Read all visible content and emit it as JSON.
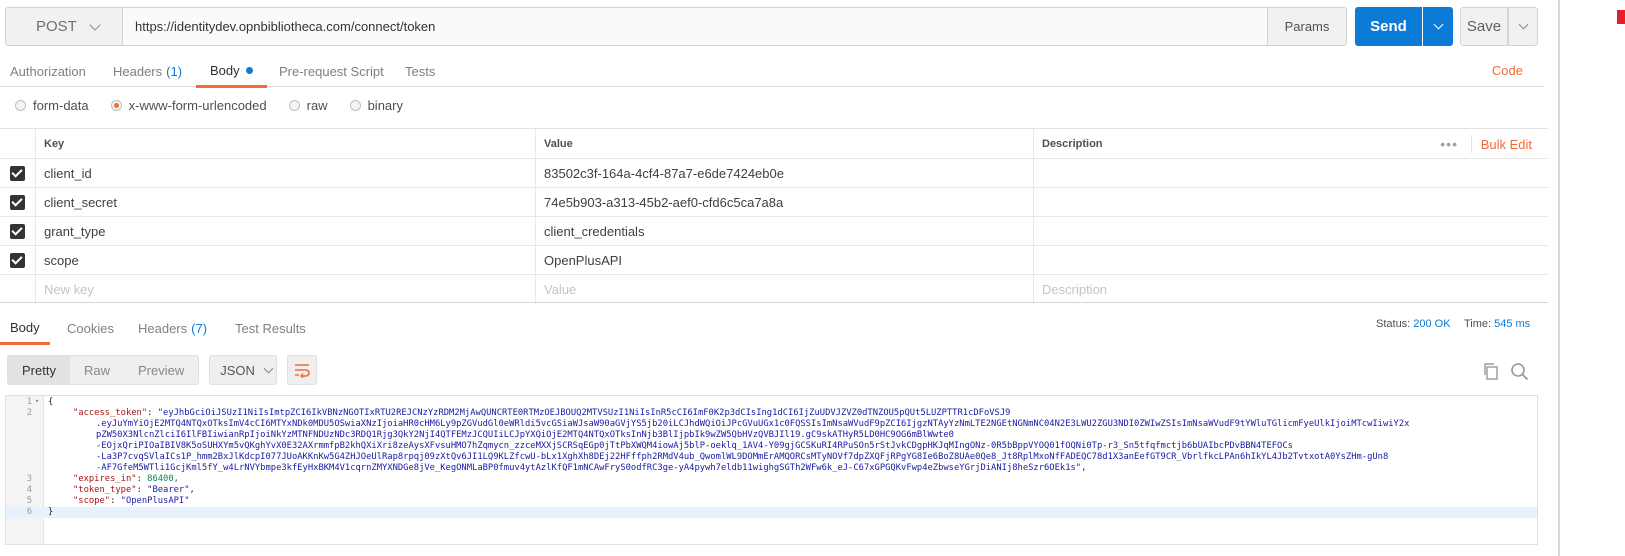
{
  "request": {
    "method": "POST",
    "url": "https://identitydev.opnbibliotheca.com/connect/token",
    "params_label": "Params",
    "send_label": "Send",
    "save_label": "Save"
  },
  "request_tabs": [
    {
      "label": "Authorization"
    },
    {
      "label": "Headers",
      "count": "(1)"
    },
    {
      "label": "Body"
    },
    {
      "label": "Pre-request Script"
    },
    {
      "label": "Tests"
    }
  ],
  "code_link": "Code",
  "body_types": [
    {
      "label": "form-data"
    },
    {
      "label": "x-www-form-urlencoded"
    },
    {
      "label": "raw"
    },
    {
      "label": "binary"
    }
  ],
  "kv_table": {
    "headers": {
      "key": "Key",
      "value": "Value",
      "description": "Description"
    },
    "more": "•••",
    "bulk_edit": "Bulk Edit",
    "rows": [
      {
        "key": "client_id",
        "value": "83502c3f-164a-4cf4-87a7-e6de7424eb0e"
      },
      {
        "key": "client_secret",
        "value": "74e5b903-a313-45b2-aef0-cfd6c5ca7a8a"
      },
      {
        "key": "grant_type",
        "value": "client_credentials"
      },
      {
        "key": "scope",
        "value": "OpenPlusAPI"
      }
    ],
    "new_row": {
      "key": "New key",
      "value": "Value",
      "description": "Description"
    }
  },
  "response_tabs": [
    {
      "label": "Body"
    },
    {
      "label": "Cookies"
    },
    {
      "label": "Headers",
      "count": "(7)"
    },
    {
      "label": "Test Results"
    }
  ],
  "status": {
    "label": "Status:",
    "value": "200 OK"
  },
  "time": {
    "label": "Time:",
    "value": "545 ms"
  },
  "view_modes": [
    "Pretty",
    "Raw",
    "Preview"
  ],
  "format": "JSON",
  "response_json": {
    "open": "{",
    "close": "}",
    "access_token_key": "\"access_token\"",
    "access_token_lines": [
      "\"eyJhbGciOiJSUzI1NiIsImtpZCI6IkVBNzNGOTIxRTU2REJCNzYzRDM2MjAwQUNCRTE0RTMzOEJBOUQ2MTVSUzI1NiIsInR5cCI6ImF0K2p3dCIsIng1dCI6IjZuUDVJZVZ0dTNZOU5pQUt5LUZPTTR1cDFoVSJ9",
      ".eyJuYmYiOjE2MTQ4NTQxOTksImV4cCI6MTYxNDk0MDU5OSwiaXNzIjoiaHR0cHM6Ly9pZGVudGl0eWRldi5vcGSiaWJsaW90aGVjYS5jb20iLCJhdWQiOiJPcGVuUGx1c0FQSSIsImNsaWVudF9pZCI6IjgzNTAyYzNmLTE2NGEtNGNmNC04N2E3LWU2ZGU3NDI0ZWIwZSIsImNsaWVudF9tYWluTGlicmFyeUlkIjoiMTcwIiwiY2x",
      "pZW50X3NlcnZlciI6IlFBIiwianRpIjoiNkYzMTNFNDUzNDc3RDQ1Rjg3QkY2NjI4QTFEMzJCQUIiLCJpYXQiOjE2MTQ4NTQxOTksInNjb3BlIjpbIk9wZW5QbHVzQVBJIl19.gC9skATHyR5LD0HC9OG6mBlWwte0",
      "-EOjxQriPIOaIBIV8K5oSUHXYm5vQKghYvX0E32AXrmmfpB2khQXiXri8zeAysXFvsuHMO7hZqmycn_zzceMXXjSCRSqEGp0jTtPbXWQM4iowAj5blP-oeklq_1AV4-Y09gjGCSKuRI4RPuSOn5rStJvkCDgpHKJqMIngONz-0R5bBppVYOQ01fOQNi0Tp-r3_Sn5tfqfmctjb6bUAIbcPDvBBN4TEFOCs",
      "-La3P7cvqSVlaICs1P_hmm2BxJlKdcpI077JUoAKKnKw5G4ZHJOeUlRap8rpqj09zXtQv6JI1LQ9KLZfcwU-bLx1XghXh8DEj22HFffph2RMdV4ub_QwomlWL9DOMmErAMQORCsMTyNOVf7dpZXQFjRPgYG8Ie6BoZ8UAe0Qe8_Jt8RplMxoNfFADEQC78d1X3anEefGT9CR_VbrlfkcLPAn6hIkYL4Jb2TvtxotA0YsZHm-gUn8",
      "-AF7GfeM5WTli1GcjKml5fY_w4LrNVYbmpe3kfEyHxBKM4V1cqrnZMYXNDGe8jVe_KegONMLaBP0fmuv4ytAzlKfQF1mNCAwFryS0odfRC3ge-yA4pywh7eldb11wighgSGTh2WFw6k_eJ-C67xGPGQKvFwp4eZbwseYGrjDiANIj8heSzr6OEk1s\","
    ],
    "expires_in_key": "\"expires_in\"",
    "expires_in_value": "86400,",
    "token_type_key": "\"token_type\"",
    "token_type_value": "\"Bearer\",",
    "scope_key": "\"scope\"",
    "scope_value": "\"OpenPlusAPI\"",
    "line_numbers": [
      "1",
      "2",
      "3",
      "4",
      "5",
      "6"
    ]
  },
  "colors": {
    "accent": "#f26b3a",
    "primary": "#0c7ad7"
  }
}
